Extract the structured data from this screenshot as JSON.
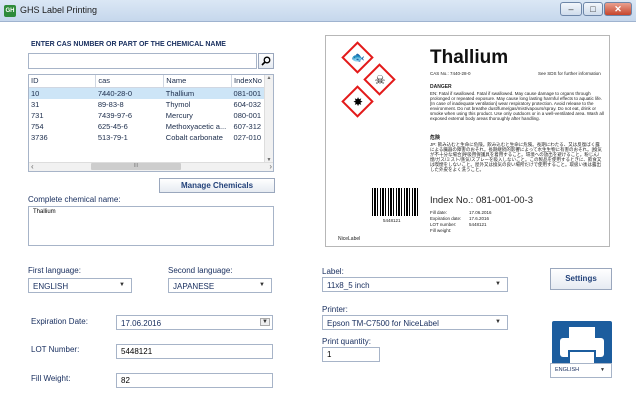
{
  "window": {
    "app_icon_text": "GH",
    "title": "GHS Label Printing",
    "minimize": "–",
    "maximize": "□",
    "close": "✕"
  },
  "search": {
    "heading": "ENTER CAS NUMBER OR PART OF THE CHEMICAL NAME",
    "value": "",
    "button_icon": "search-icon"
  },
  "table": {
    "columns": [
      "ID",
      "cas",
      "Name",
      "IndexNo"
    ],
    "rows": [
      {
        "id": "10",
        "cas": "7440-28-0",
        "name": "Thallium",
        "index": "081-001",
        "selected": true
      },
      {
        "id": "31",
        "cas": "89-83-8",
        "name": "Thymol",
        "index": "604-032",
        "selected": false
      },
      {
        "id": "731",
        "cas": "7439-97-6",
        "name": "Mercury",
        "index": "080-001",
        "selected": false
      },
      {
        "id": "754",
        "cas": "625-45-6",
        "name": "Methoxyacetic a...",
        "index": "607-312",
        "selected": false
      },
      {
        "id": "3736",
        "cas": "513-79-1",
        "name": "Cobalt carbonate",
        "index": "027-010",
        "selected": false
      }
    ],
    "scroll_left": "‹",
    "scroll_right": "›",
    "scroll_thumb": "III"
  },
  "manage_chemicals_label": "Manage Chemicals",
  "complete_name": {
    "label": "Complete chemical name:",
    "value": "Thallium"
  },
  "first_language": {
    "label": "First language:",
    "value": "ENGLISH"
  },
  "second_language": {
    "label": "Second language:",
    "value": "JAPANESE"
  },
  "expiration": {
    "label": "Expiration Date:",
    "value": "17.06.2016"
  },
  "lot": {
    "label": "LOT Number:",
    "value": "5448121"
  },
  "fill_weight": {
    "label": "Fill Weight:",
    "value": "82"
  },
  "label_select": {
    "label": "Label:",
    "value": "11x8_5 inch"
  },
  "printer_select": {
    "label": "Printer:",
    "value": "Epson TM-C7500 for NiceLabel"
  },
  "print_quantity": {
    "label": "Print quantity:",
    "value": "1"
  },
  "settings_label": "Settings",
  "ui_language": {
    "value": "ENGLISH"
  },
  "preview": {
    "product_name": "Thallium",
    "cas_line": "CAS No.: 7440-28-0",
    "sds_note": "See SDS for further information",
    "signal": "DANGER",
    "hazard_en": "EN: Fatal if swallowed. Fatal if swallowed. May cause damage to organs through prolonged or repeated exposure. May cause long lasting harmful effects to aquatic life. [In case of inadequate ventilation] wear respiratory protection. Avoid release to the environment. Do not breathe dust/fume/gas/mist/vapours/spray. Do not eat, drink or smoke when using this product. Use only outdoors or in a well-ventilated area. Wash all exposed external body areas thoroughly after handling.",
    "jp_heading": "危険",
    "hazard_jp": "JP: 飲み込むと生命に危険。飲み込むと生命に危険。長期にわたる、又は反復ばく露による臓器の障害のおそれ。長期継続的影響によって水生生物に有害のおそれ。[換気が不十分な場合]呼吸用保護具を着用すること。環境への放出を避けること。粉じん/煙/ガス/ミスト/蒸気/スプレーを吸入しないこと。この製品を使用するときに、飲食又は喫煙をしないこと。屋外又は換気の良い場所だけで使用すること。取扱い後は露出した外皮をよく洗うこと。",
    "barcode_number": "5448121",
    "brand": "NiceLabel",
    "index_line": "Index No.: 081-001-00-3",
    "fill_date_label": "Fill date:",
    "fill_date": "17.06.2016",
    "expiration_label": "Expiration date:",
    "expiration": "17.6.2016",
    "lot_label": "LOT number:",
    "lot": "5448121",
    "weight_label": "Fill weight:"
  }
}
